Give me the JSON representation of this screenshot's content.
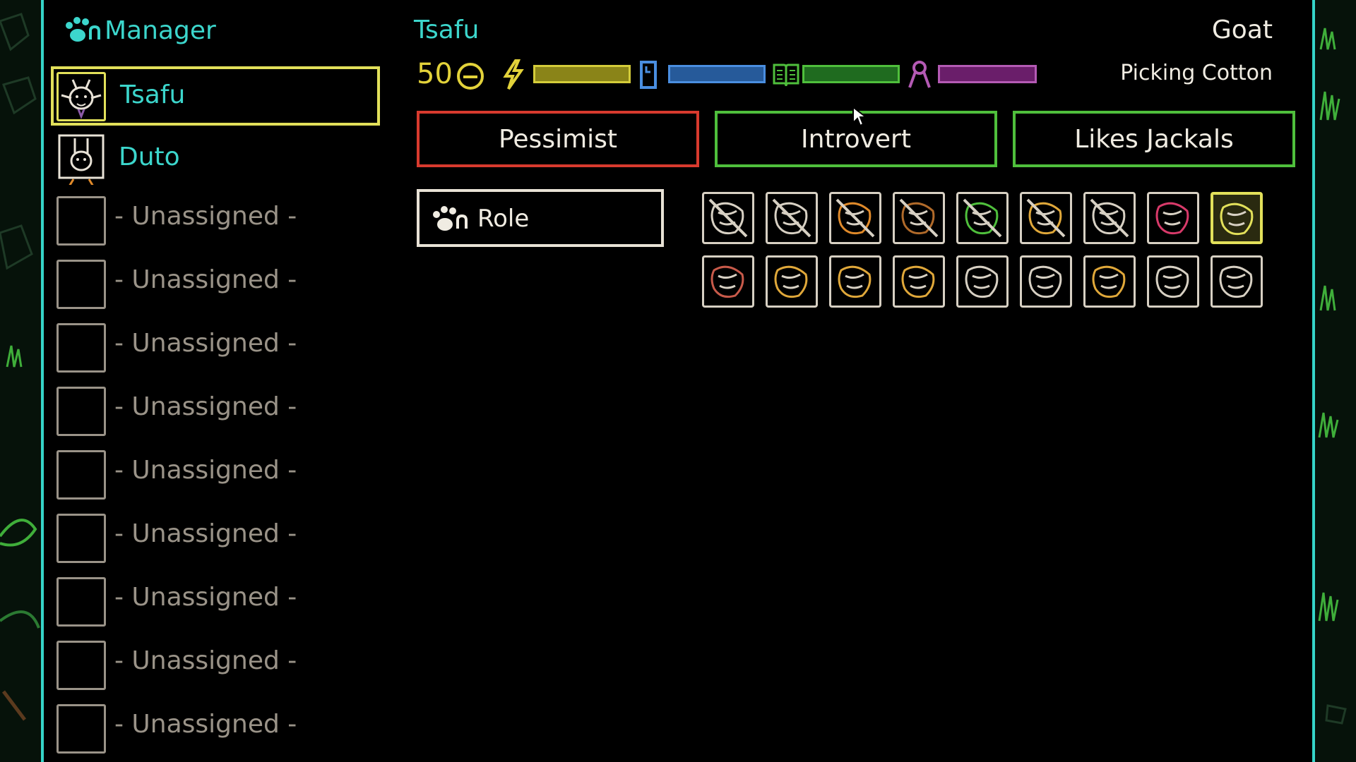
{
  "sidebar": {
    "title": "Manager",
    "pawns": [
      {
        "name": "Tsafu",
        "selected": true
      },
      {
        "name": "Duto",
        "selected": false
      }
    ],
    "unassigned_label": "- Unassigned -",
    "unassigned_count": 9
  },
  "pawn": {
    "name": "Tsafu",
    "species": "Goat",
    "activity": "Picking Cotton",
    "mood_value": "50",
    "bars": [
      {
        "icon": "lightning-icon",
        "color": "#b9b22a",
        "fill": 1.0
      },
      {
        "icon": "phone-icon",
        "color": "#3a78c4",
        "fill": 1.0
      },
      {
        "icon": "book-icon",
        "color": "#3a9a38",
        "fill": 1.0
      },
      {
        "icon": "ribbon-icon",
        "color": "#8c2e8c",
        "fill": 1.0
      }
    ],
    "traits": [
      {
        "label": "Pessimist",
        "color": "#d83a2e"
      },
      {
        "label": "Introvert",
        "color": "#4fbf3c"
      },
      {
        "label": "Likes Jackals",
        "color": "#4fbf3c"
      }
    ],
    "role_label": "Role"
  },
  "jobs": [
    "pickaxe-icon",
    "rock-icon",
    "fishing-icon",
    "log-icon",
    "leaf-icon",
    "hay-icon",
    "crossed-icon",
    "hands-icon",
    "hands-selected-icon",
    "feather-icon",
    "barn-icon",
    "saw-icon",
    "potion-icon",
    "anvil-icon",
    "bell-icon",
    "gear-icon",
    "loom-icon",
    "scroll-icon"
  ],
  "colors": {
    "accent": "#3cd6cc",
    "selection": "#e2e05a",
    "muted": "#9a9388"
  }
}
